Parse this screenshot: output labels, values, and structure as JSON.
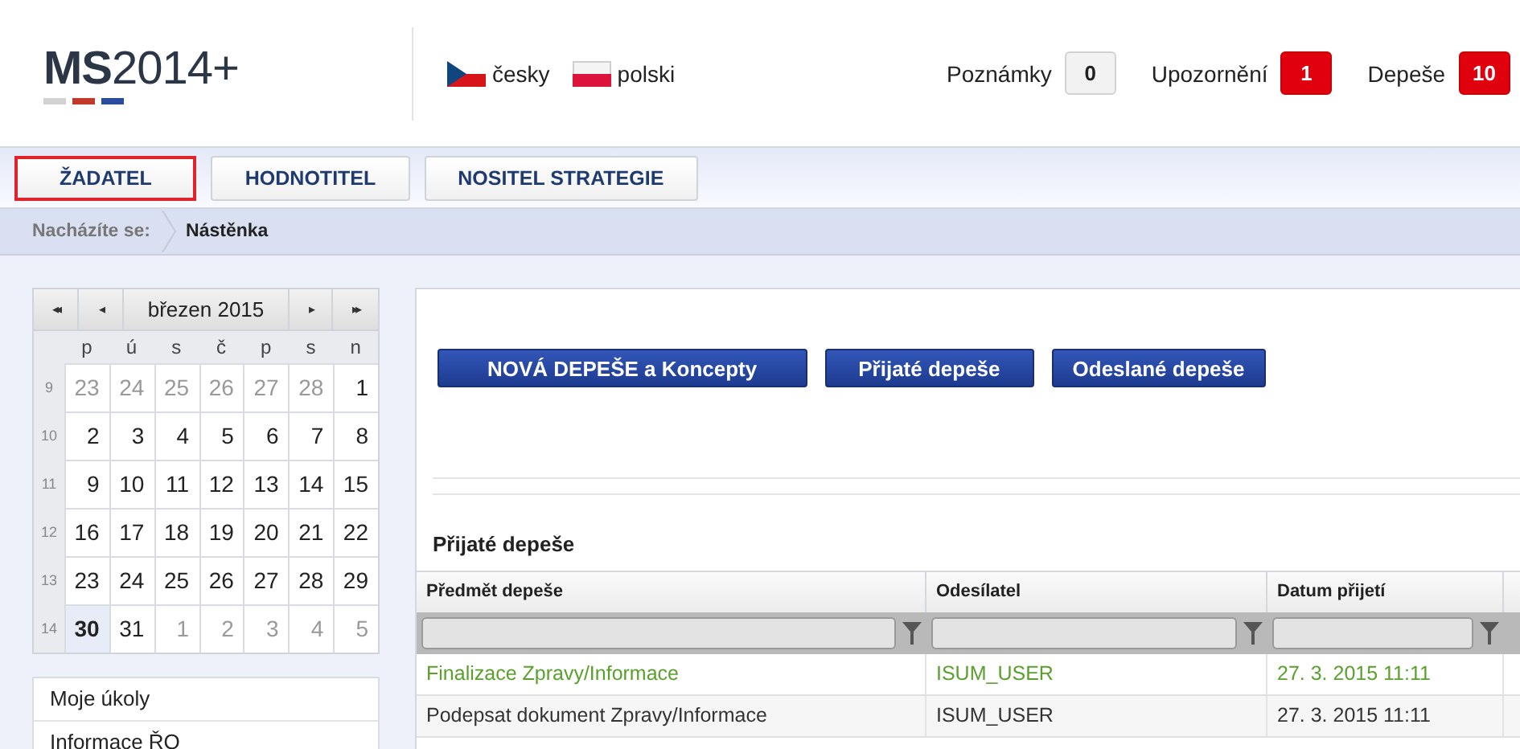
{
  "header": {
    "logo": {
      "bold": "MS",
      "rest": "2014+"
    },
    "languages": [
      {
        "label": "česky",
        "kind": "cz"
      },
      {
        "label": "polski",
        "kind": "pl"
      }
    ],
    "counters": [
      {
        "label": "Poznámky",
        "count": "0",
        "alert": false
      },
      {
        "label": "Upozornění",
        "count": "1",
        "alert": true
      },
      {
        "label": "Depeše",
        "count": "10",
        "alert": true
      }
    ]
  },
  "role_tabs": [
    {
      "label": "ŽADATEL",
      "selected": true
    },
    {
      "label": "HODNOTITEL",
      "selected": false
    },
    {
      "label": "NOSITEL STRATEGIE",
      "selected": false
    }
  ],
  "breadcrumb": {
    "label": "Nacházíte se:",
    "current": "Nástěnka"
  },
  "calendar": {
    "nav": [
      "◂◂",
      "◂",
      "▸",
      "▸▸"
    ],
    "month": "březen 2015",
    "weekdays": [
      "p",
      "ú",
      "s",
      "č",
      "p",
      "s",
      "n"
    ],
    "weeks": [
      {
        "number": "9",
        "days": [
          {
            "day": "23",
            "other": true,
            "selected": false
          },
          {
            "day": "24",
            "other": true,
            "selected": false
          },
          {
            "day": "25",
            "other": true,
            "selected": false
          },
          {
            "day": "26",
            "other": true,
            "selected": false
          },
          {
            "day": "27",
            "other": true,
            "selected": false
          },
          {
            "day": "28",
            "other": true,
            "selected": false
          },
          {
            "day": "1",
            "other": false,
            "selected": false
          }
        ]
      },
      {
        "number": "10",
        "days": [
          {
            "day": "2",
            "other": false,
            "selected": false
          },
          {
            "day": "3",
            "other": false,
            "selected": false
          },
          {
            "day": "4",
            "other": false,
            "selected": false
          },
          {
            "day": "5",
            "other": false,
            "selected": false
          },
          {
            "day": "6",
            "other": false,
            "selected": false
          },
          {
            "day": "7",
            "other": false,
            "selected": false
          },
          {
            "day": "8",
            "other": false,
            "selected": false
          }
        ]
      },
      {
        "number": "11",
        "days": [
          {
            "day": "9",
            "other": false,
            "selected": false
          },
          {
            "day": "10",
            "other": false,
            "selected": false
          },
          {
            "day": "11",
            "other": false,
            "selected": false
          },
          {
            "day": "12",
            "other": false,
            "selected": false
          },
          {
            "day": "13",
            "other": false,
            "selected": false
          },
          {
            "day": "14",
            "other": false,
            "selected": false
          },
          {
            "day": "15",
            "other": false,
            "selected": false
          }
        ]
      },
      {
        "number": "12",
        "days": [
          {
            "day": "16",
            "other": false,
            "selected": false
          },
          {
            "day": "17",
            "other": false,
            "selected": false
          },
          {
            "day": "18",
            "other": false,
            "selected": false
          },
          {
            "day": "19",
            "other": false,
            "selected": false
          },
          {
            "day": "20",
            "other": false,
            "selected": false
          },
          {
            "day": "21",
            "other": false,
            "selected": false
          },
          {
            "day": "22",
            "other": false,
            "selected": false
          }
        ]
      },
      {
        "number": "13",
        "days": [
          {
            "day": "23",
            "other": false,
            "selected": false
          },
          {
            "day": "24",
            "other": false,
            "selected": false
          },
          {
            "day": "25",
            "other": false,
            "selected": false
          },
          {
            "day": "26",
            "other": false,
            "selected": false
          },
          {
            "day": "27",
            "other": false,
            "selected": false
          },
          {
            "day": "28",
            "other": false,
            "selected": false
          },
          {
            "day": "29",
            "other": false,
            "selected": false
          }
        ]
      },
      {
        "number": "14",
        "days": [
          {
            "day": "30",
            "other": false,
            "selected": true
          },
          {
            "day": "31",
            "other": false,
            "selected": false
          },
          {
            "day": "1",
            "other": true,
            "selected": false
          },
          {
            "day": "2",
            "other": true,
            "selected": false
          },
          {
            "day": "3",
            "other": true,
            "selected": false
          },
          {
            "day": "4",
            "other": true,
            "selected": false
          },
          {
            "day": "5",
            "other": true,
            "selected": false
          }
        ]
      }
    ]
  },
  "side_menu": [
    "Moje úkoly",
    "Informace ŘO"
  ],
  "action_buttons": [
    "NOVÁ DEPEŠE a Koncepty",
    "Přijaté depeše",
    "Odeslané depeše"
  ],
  "table": {
    "title": "Přijaté depeše",
    "columns": [
      "Předmět depeše",
      "Odesílatel",
      "Datum přijetí"
    ],
    "rows": [
      {
        "cells": [
          "Finalizace Zpravy/Informace",
          "ISUM_USER",
          "27. 3. 2015 11:11"
        ],
        "highlighted": true
      },
      {
        "cells": [
          "Podepsat dokument Zpravy/Informace",
          "ISUM_USER",
          "27. 3. 2015 11:11"
        ],
        "highlighted": false
      }
    ]
  }
}
